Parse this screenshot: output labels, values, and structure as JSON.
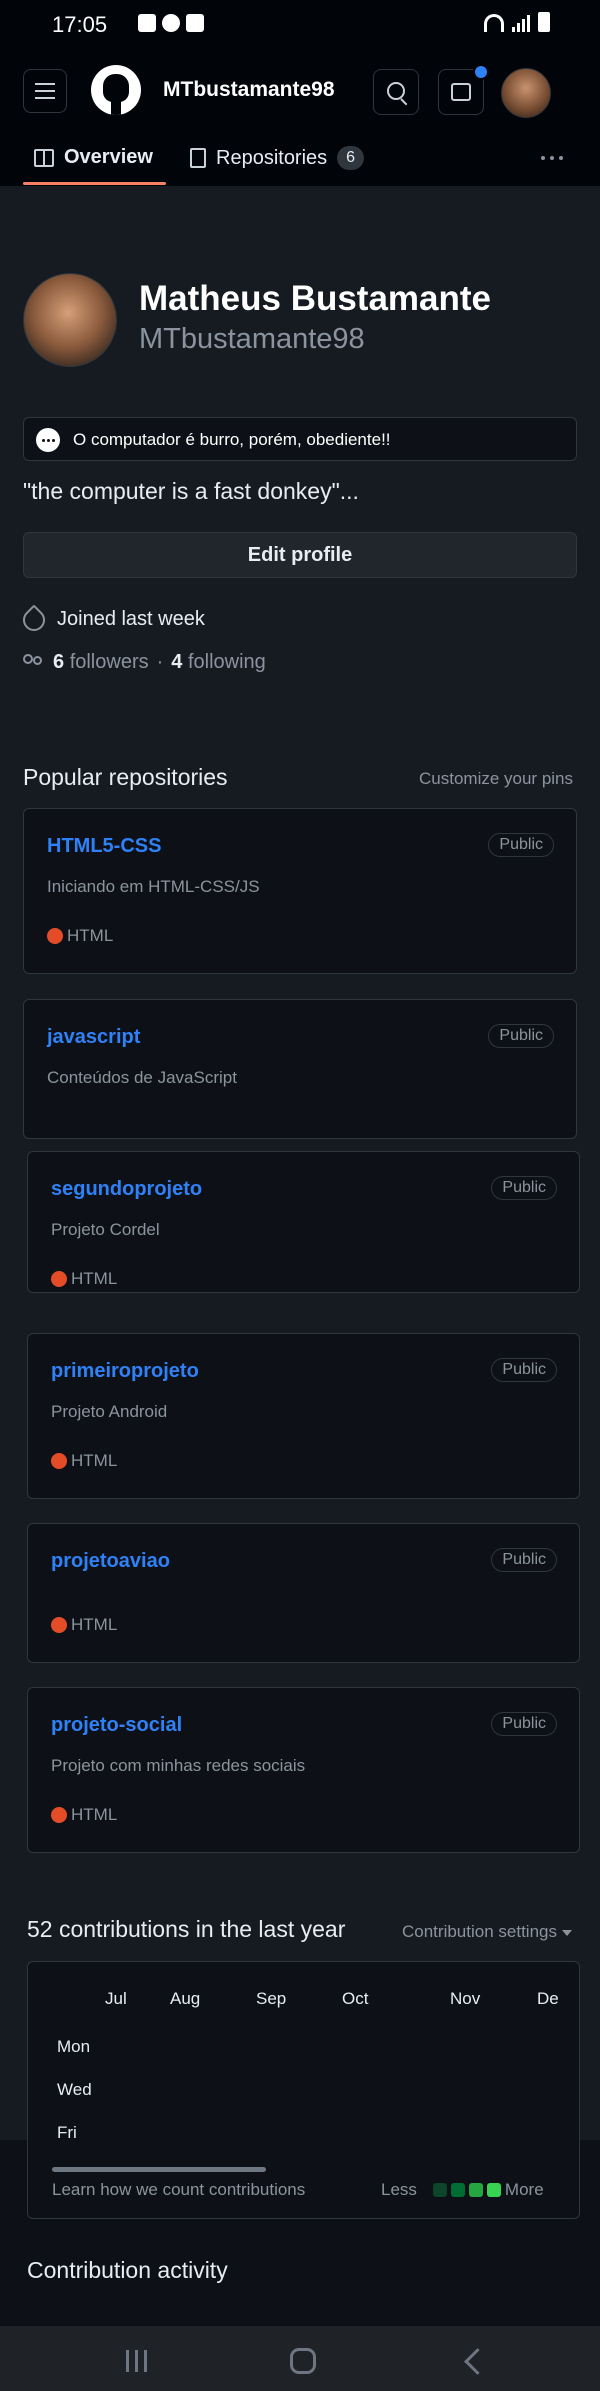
{
  "status_bar": {
    "time": "17:05"
  },
  "header": {
    "username": "MTbustamante98",
    "tabs": [
      {
        "label": "Overview"
      },
      {
        "label": "Repositories",
        "count": "6"
      }
    ]
  },
  "profile": {
    "name": "Matheus Bustamante",
    "login": "MTbustamante98",
    "status": "O computador é burro, porém, obediente!!",
    "bio": "\"the computer is a fast donkey\"...",
    "edit_button": "Edit profile",
    "joined": "Joined last week",
    "followers_count": "6",
    "followers_label": "followers",
    "separator": "·",
    "following_count": "4",
    "following_label": "following"
  },
  "popular": {
    "title": "Popular repositories",
    "customize": "Customize your pins",
    "repos": [
      {
        "name": "HTML5-CSS",
        "visibility": "Public",
        "description": "Iniciando em HTML-CSS/JS",
        "language": "HTML"
      },
      {
        "name": "javascript",
        "visibility": "Public",
        "description": "Conteúdos de JavaScript",
        "language": ""
      },
      {
        "name": "segundoprojeto",
        "visibility": "Public",
        "description": "Projeto Cordel",
        "language": "HTML"
      },
      {
        "name": "primeiroprojeto",
        "visibility": "Public",
        "description": "Projeto Android",
        "language": "HTML"
      },
      {
        "name": "projetoaviao",
        "visibility": "Public",
        "description": "",
        "language": "HTML"
      },
      {
        "name": "projeto-social",
        "visibility": "Public",
        "description": "Projeto com minhas redes sociais",
        "language": "HTML"
      }
    ],
    "language_color": "#e34c26"
  },
  "contributions": {
    "title": "52 contributions in the last year",
    "settings": "Contribution settings",
    "months": [
      "Jul",
      "Aug",
      "Sep",
      "Oct",
      "Nov",
      "De"
    ],
    "days": [
      "Mon",
      "Wed",
      "Fri"
    ],
    "learn": "Learn how we count contributions",
    "less": "Less",
    "more": "More",
    "legend_colors": [
      "#0e4429",
      "#006d32",
      "#26a641",
      "#39d353"
    ]
  },
  "activity": {
    "title": "Contribution activity"
  },
  "colors": {
    "accent": "#2f81f7",
    "tab_underline": "#f78166",
    "notification": "#2f81f7"
  }
}
